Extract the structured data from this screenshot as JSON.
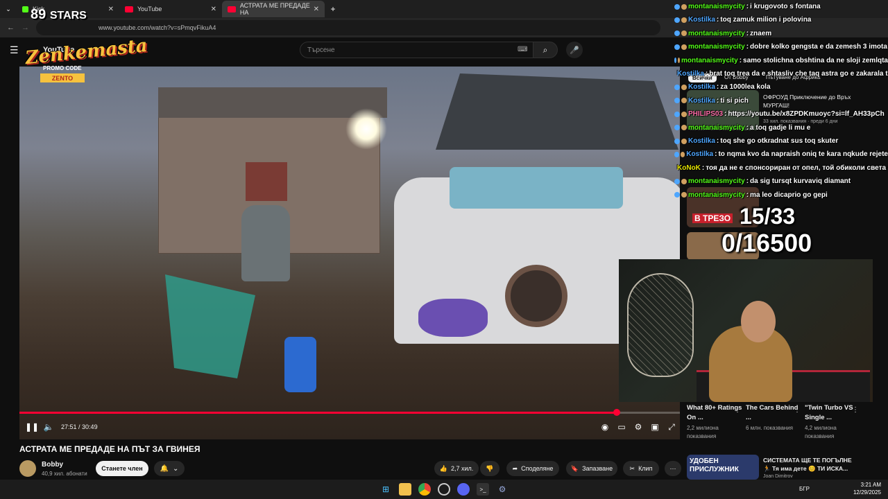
{
  "browser": {
    "tabs": [
      {
        "label": "Kick",
        "icon": "kick-icon",
        "active": false
      },
      {
        "label": "YouTube",
        "icon": "youtube-icon",
        "active": false
      },
      {
        "label": "АСТРАТА МЕ ПРЕДАДЕ НА",
        "icon": "youtube-icon",
        "active": true
      }
    ],
    "url": "www.youtube.com/watch?v=sPmqvFikuA4"
  },
  "overlay": {
    "stars_label": "STARS",
    "stars_number": "89",
    "logo": "Zenkemasta",
    "promo_label": "PROMO CODE",
    "promo_code": "ZENTO",
    "counter_top": "15/33",
    "counter_bottom": "0/16500"
  },
  "youtube": {
    "logo": "YouTube",
    "search_placeholder": "Търсене",
    "video": {
      "title": "АСТРАТА МЕ ПРЕДАДЕ НА ПЪТ ЗА ГВИНЕЯ",
      "time_current": "27:51",
      "time_total": "30:49",
      "progress": 0.904
    },
    "channel": {
      "name": "Bobby",
      "subs": "40,9 хил. абонати"
    },
    "buttons": {
      "member": "Станете член",
      "likes": "2,7 хил.",
      "share": "Споделяне",
      "save": "Запазване",
      "clip": "Клип"
    },
    "recommendations_bottom": [
      {
        "title": "What 80+ Ratings On ...",
        "meta": "2,2 милиона показвания"
      },
      {
        "title": "The Cars Behind ...",
        "meta": "6 млн. показвания"
      },
      {
        "title": "\"Twin Turbo VS Single ...",
        "meta": "4,2 милиона показвания"
      }
    ],
    "sidebar_hidden": [
      {
        "title": "ОФРОУД Приключение до Връх МУРГАШ!",
        "meta": "33 хил. показвания · преди 6 дни"
      },
      {
        "title": "СИСТЕМАТА ЩЕ ТЕ ПОГЪЛНЕ 🏃 Тя има дете 😊 ТИ ИСКА...",
        "meta": "Joan Dimitrov"
      }
    ],
    "tags": [
      "Всички",
      "От Bobby",
      "Пътуване до Африка"
    ],
    "thumb_banner": "УДОБЕН ПРИСЛУЖНИК",
    "thumb_label": "В ТРЕЗО"
  },
  "chat": [
    {
      "user": "montanaismycity",
      "msg": "i krugovoto s fontana",
      "color": "green"
    },
    {
      "user": "Kostilka",
      "msg": "toq zamuk milion i polovina",
      "color": "blue"
    },
    {
      "user": "montanaismycity",
      "msg": "znaem",
      "color": "green"
    },
    {
      "user": "montanaismycity",
      "msg": "dobre kolko gengsta e da zemesh 3 imota",
      "color": "green"
    },
    {
      "user": "montanaismycity",
      "msg": "samo stolichna obshtina da ne sloji zemlqta",
      "color": "green"
    },
    {
      "user": "Kostilka",
      "msg": "brat toq trea da e shtasliv che taq astra go e zakarala tam",
      "color": "blue"
    },
    {
      "user": "Kostilka",
      "msg": "za 1000lea kola",
      "color": "blue"
    },
    {
      "user": "Kostilka",
      "msg": "ti si pich",
      "color": "blue"
    },
    {
      "user": "PHILIPS03",
      "msg": "https://youtu.be/x8ZPDKmuoyc?si=lf_AH33pCh",
      "color": "pink"
    },
    {
      "user": "montanaismycity",
      "msg": "a toq gadje li mu e",
      "color": "green"
    },
    {
      "user": "Kostilka",
      "msg": "toq she go otkradnat sus toq skuter",
      "color": "blue"
    },
    {
      "user": "Kostilka",
      "msg": "to nqma kvo da napraish oniq te kara nqkude rejete",
      "color": "blue"
    },
    {
      "user": "KoNoK",
      "msg": "тоя да не е спонсориран от опел, той обиколи света с тоя катафалк",
      "color": "yellow"
    },
    {
      "user": "montanaismycity",
      "msg": "da sig tursqt kurvaviq diamant",
      "color": "green"
    },
    {
      "user": "montanaismycity",
      "msg": "ma leo dicaprio go gepi",
      "color": "green"
    }
  ],
  "taskbar": {
    "language": "БГР",
    "time": "3:21 AM",
    "date": "12/29/2025"
  },
  "colors": {
    "accent": "#ff0033",
    "chat_green": "#53fc18",
    "chat_blue": "#4ea6ff"
  }
}
